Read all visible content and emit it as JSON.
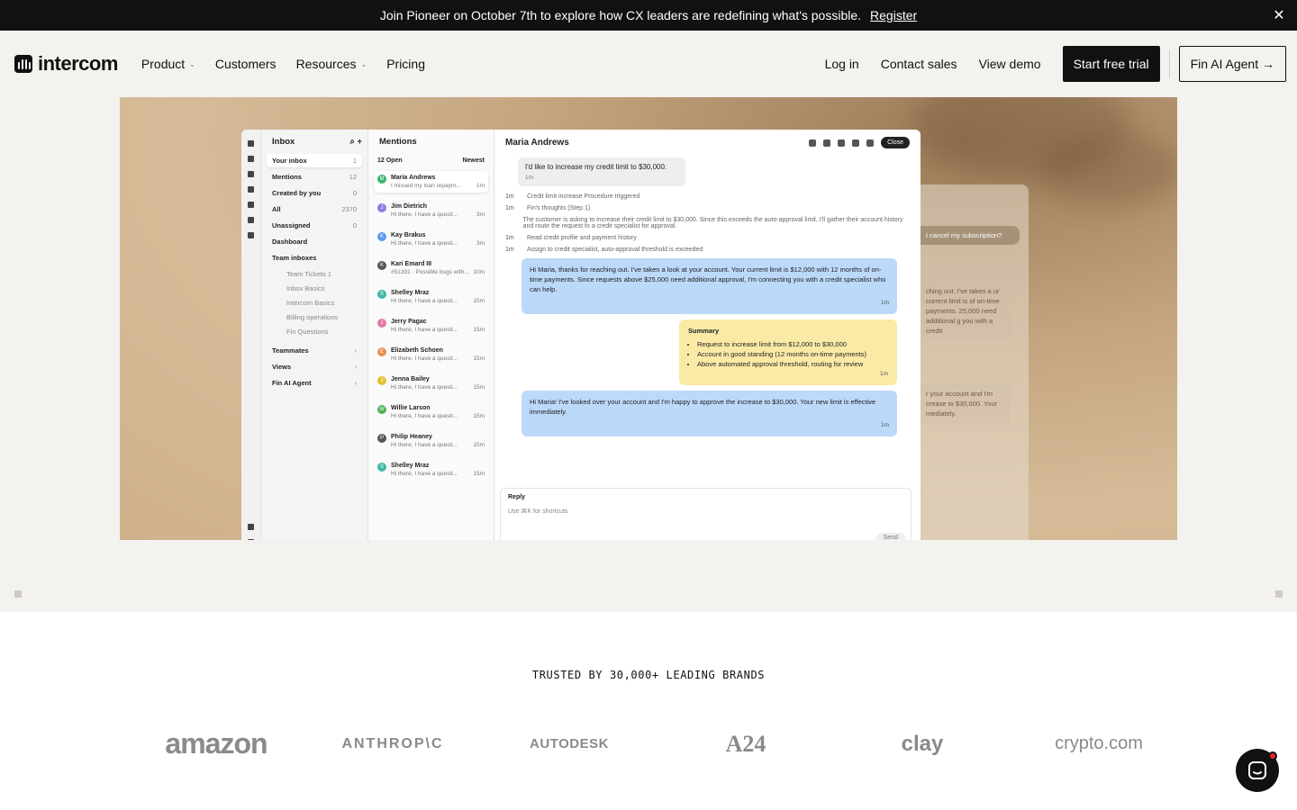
{
  "announcement": {
    "text": "Join Pioneer on October 7th to explore how CX leaders are redefining what's possible.",
    "link": "Register"
  },
  "nav": {
    "logo": "intercom",
    "links": [
      "Product",
      "Customers",
      "Resources",
      "Pricing"
    ],
    "login": "Log in",
    "contact": "Contact sales",
    "demo": "View demo",
    "trial": "Start free trial",
    "fin": "Fin AI Agent →"
  },
  "app": {
    "inbox_title": "Inbox",
    "inbox_items": [
      {
        "label": "Your inbox",
        "count": "1"
      },
      {
        "label": "Mentions",
        "count": "12"
      },
      {
        "label": "Created by you",
        "count": "0"
      },
      {
        "label": "All",
        "count": "2370"
      },
      {
        "label": "Unassigned",
        "count": "0"
      },
      {
        "label": "Dashboard",
        "count": ""
      },
      {
        "label": "Team inboxes",
        "count": ""
      }
    ],
    "team_inboxes": [
      "Team Tickets 1",
      "Inbox Basics",
      "Intercom Basics",
      "Billing operations",
      "Fin Questions"
    ],
    "other_sections": [
      "Teammates",
      "Views",
      "Fin AI Agent"
    ],
    "mentions_title": "Mentions",
    "filter_open": "12 Open",
    "filter_sort": "Newest",
    "conversations": [
      {
        "name": "Maria Andrews",
        "snippet": "I missed my loan repaym...",
        "time": "1m",
        "color": "#3cb371",
        "initial": "M"
      },
      {
        "name": "Jim Dietrich",
        "snippet": "Hi there, I have a questi...",
        "time": "3m",
        "color": "#8f7be0",
        "initial": "J"
      },
      {
        "name": "Kay Brakus",
        "snippet": "Hi there, I have a questi...",
        "time": "3m",
        "color": "#5a9ae8",
        "initial": "K"
      },
      {
        "name": "Kari Emard III",
        "snippet": "#51391 · Possible bugs with...",
        "time": "10m",
        "color": "#555555",
        "initial": "K"
      },
      {
        "name": "Shelley Mraz",
        "snippet": "Hi there, I have a questi...",
        "time": "15m",
        "color": "#3fb8a6",
        "initial": "S"
      },
      {
        "name": "Jerry Pagac",
        "snippet": "Hi there, I have a questi...",
        "time": "15m",
        "color": "#e07ba4",
        "initial": "J"
      },
      {
        "name": "Elizabeth Schoen",
        "snippet": "Hi there, I have a questi...",
        "time": "15m",
        "color": "#e8904f",
        "initial": "E"
      },
      {
        "name": "Jenna Bailey",
        "snippet": "Hi there, I have a questi...",
        "time": "15m",
        "color": "#e3c22f",
        "initial": "J"
      },
      {
        "name": "Willie Larson",
        "snippet": "Hi there, I have a questi...",
        "time": "15m",
        "color": "#4fb24f",
        "initial": "W"
      },
      {
        "name": "Philip Heaney",
        "snippet": "Hi there, I have a questi...",
        "time": "15m",
        "color": "#555555",
        "initial": "P"
      },
      {
        "name": "Shelley Mraz",
        "snippet": "Hi there, I have a questi...",
        "time": "15m",
        "color": "#3fb8a6",
        "initial": "S"
      }
    ],
    "chat_title": "Maria Andrews",
    "close_label": "Close",
    "customer_msg": "I'd like to increase my credit limit to $30,000.",
    "customer_time": "1m",
    "system_lines": [
      {
        "t": "1m",
        "text": "Credit limit increase Procedure triggered"
      },
      {
        "t": "1m",
        "text": "Fin's thoughts (Step 1)"
      },
      {
        "t": "",
        "text": "The customer is asking to increase their credit limit to $30,000. Since this exceeds the auto-approval limit, I'll gather their account history and route the request to a credit specialist for approval."
      },
      {
        "t": "1m",
        "text": "Read credit profile and payment history"
      },
      {
        "t": "1m",
        "text": "Assign to credit specialist, auto-approval threshold is exceeded"
      }
    ],
    "fin_msg": "Hi Maria, thanks for reaching out. I've taken a look at your account. Your current limit is $12,000 with 12 months of on-time payments. Since requests above $25,000 need additional approval, I'm connecting you with a credit specialist who can help.",
    "fin_time": "1m",
    "summary_title": "Summary",
    "summary_items": [
      "Request to increase limit from $12,000 to $30,000",
      "Account in good standing (12 months on-time payments)",
      "Above automated approval threshold, routing for review"
    ],
    "summary_time": "1m",
    "agent_msg": "Hi Maria! I've looked over your account and I'm happy to approve the increase to $30,000. Your new limit is effective immediately.",
    "agent_time": "1m",
    "reply_label": "Reply",
    "reply_placeholder": "Use ⌘K for shortcuts",
    "send_label": "Send",
    "ghost_pill": "I cancel my subscription?",
    "ghost_para1": "ching out. I've taken a ur current limit is of on-time payments. 25,000 need additional g you with a credit",
    "ghost_para2": "r your account and I'm crease to $30,000. Your mediately."
  },
  "trusted": {
    "title": "TRUSTED BY 30,000+ LEADING BRANDS",
    "logos": [
      "amazon",
      "ANTHROP\\C",
      "AUTODESK",
      "A24",
      "clay",
      "crypto.com"
    ]
  }
}
